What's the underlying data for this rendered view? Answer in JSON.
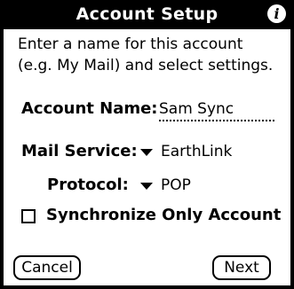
{
  "window": {
    "title": "Account Setup"
  },
  "intro": {
    "line1": "Enter a name for this account",
    "line2": "(e.g. My Mail) and select settings."
  },
  "account_name": {
    "label": "Account Name:",
    "value": "Sam Sync"
  },
  "mail_service": {
    "label": "Mail Service:",
    "value": "EarthLink"
  },
  "protocol": {
    "label": "Protocol:",
    "value": "POP"
  },
  "sync_only": {
    "label": "Synchronize Only Account",
    "checked": false
  },
  "buttons": {
    "cancel": "Cancel",
    "next": "Next"
  },
  "icons": {
    "info": "info-icon",
    "dropdown": "triangle-down-icon"
  }
}
